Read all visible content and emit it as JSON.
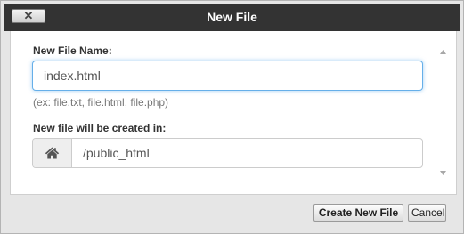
{
  "dialog": {
    "title": "New File",
    "close_label": "✕"
  },
  "form": {
    "filename_label": "New File Name:",
    "filename_value": "index.html",
    "filename_hint": "(ex: file.txt, file.html, file.php)",
    "location_label": "New file will be created in:",
    "location_value": "/public_html",
    "location_icon": "home-icon"
  },
  "footer": {
    "create_label": "Create New File",
    "cancel_label": "Cancel"
  },
  "colors": {
    "titlebar": "#333333",
    "focus_border": "#66afe9"
  }
}
